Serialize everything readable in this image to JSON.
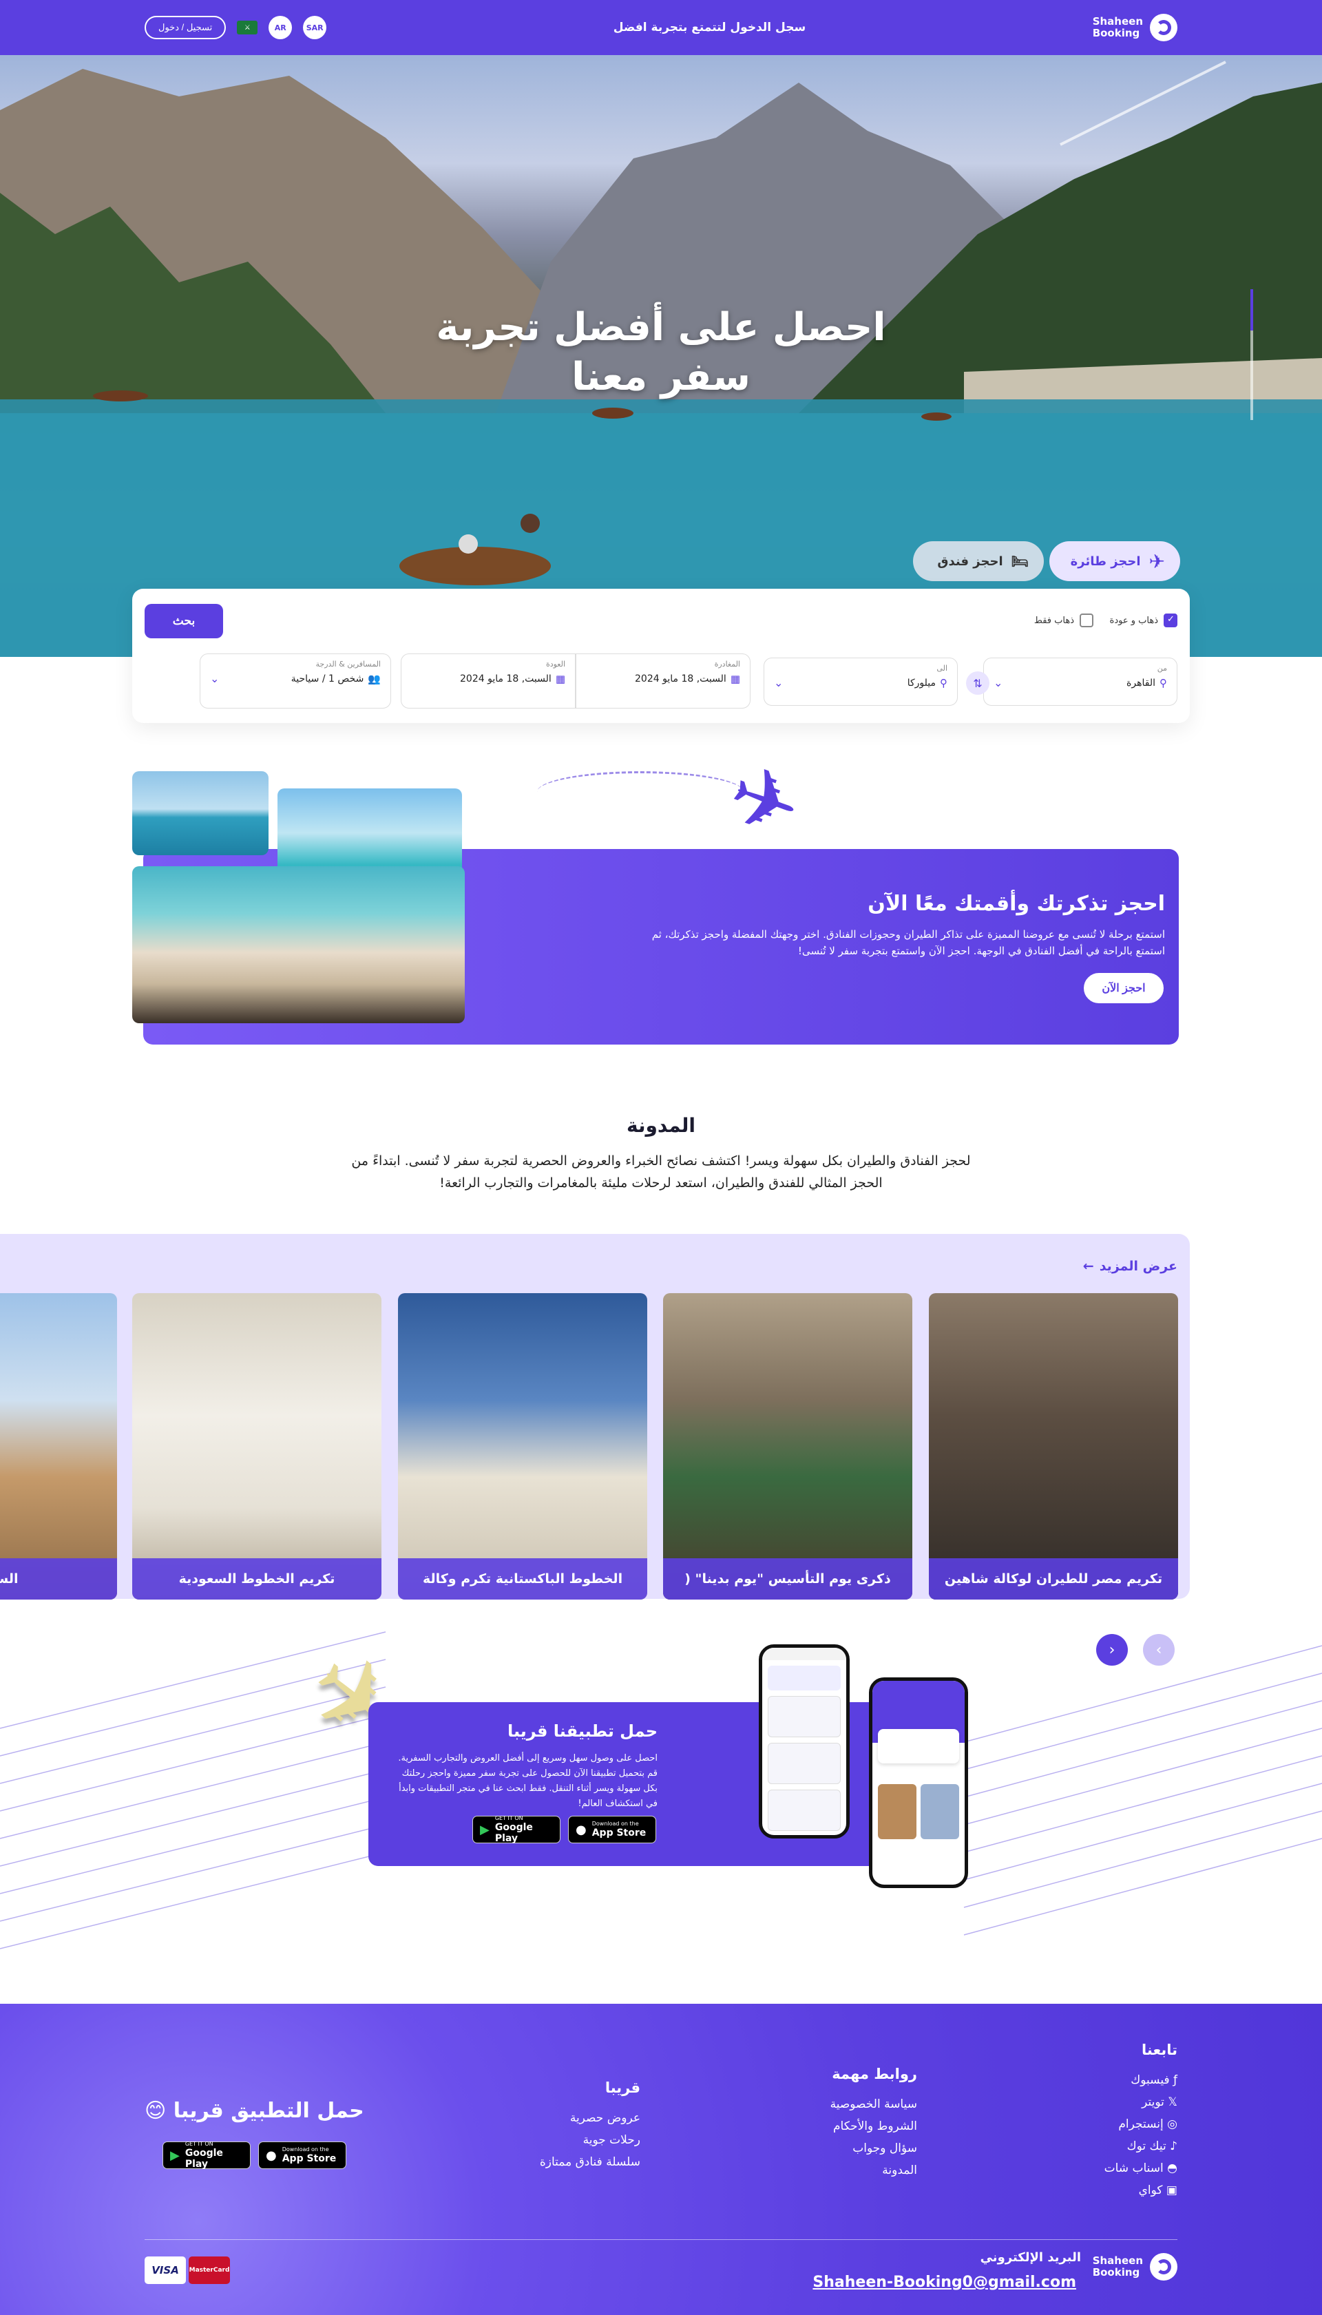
{
  "header": {
    "brand_line1": "Shaheen",
    "brand_line2": "Booking",
    "center_text": "سجل الدخول لتتمتع بتجربة افضل",
    "login_label": "تسجيل / دخول",
    "lang_label": "AR",
    "currency_label": "SAR"
  },
  "hero": {
    "title_line1": "احصل على أفضل تجربة",
    "title_line2": "سفر معنا"
  },
  "tabs": {
    "flight": "احجز طائرة",
    "hotel": "احجز فندق"
  },
  "search": {
    "round_trip": "ذهاب و عودة",
    "one_way": "ذهاب فقط",
    "search_button": "بحث",
    "from_label": "من",
    "from_value": "القاهرة",
    "to_label": "الى",
    "to_value": "ميلوركا",
    "depart_label": "المغادرة",
    "depart_value": "السبت, 18 مايو 2024",
    "return_label": "العودة",
    "return_value": "السبت, 18 مايو 2024",
    "pax_label": "المسافرين & الدرجة",
    "pax_value": "شخص 1 / سياحية"
  },
  "promo": {
    "title": "احجز تذكرتك وأقمتك معًا الآن",
    "text": "استمتع برحلة لا تُنسى مع عروضنا المميزة على تذاكر الطيران وحجوزات الفنادق. اختر وجهتك المفضلة واحجز تذكرتك، ثم استمتع بالراحة في أفضل الفنادق في الوجهة. احجز الآن واستمتع بتجربة سفر لا تُنسى!",
    "button": "احجز الآن"
  },
  "blog": {
    "title": "المدونة",
    "text": "لحجز الفنادق والطيران بكل سهولة ويسر! اكتشف نصائح الخبراء والعروض الحصرية لتجربة سفر لا تُنسى. ابتداءً من الحجز المثالي للفندق والطيران، استعد لرحلات مليئة بالمغامرات والتجارب الرائعة!",
    "more": "عرض المزيد",
    "cards": [
      {
        "caption": "تكريم مصر للطيران لوكالة شاهين"
      },
      {
        "caption": "ذكرى يوم التأسيس \"يوم بدينا\" ("
      },
      {
        "caption": "الخطوط الباكستانية تكرم وكالة"
      },
      {
        "caption": "تكريم الخطوط السعودية"
      },
      {
        "caption": "السياحة"
      }
    ]
  },
  "app": {
    "title": "حمل تطبيقنا قريبا",
    "text": "احصل على وصول سهل وسريع إلى أفضل العروض والتجارب السفرية. قم بتحميل تطبيقنا الآن للحصول على تجربة سفر مميزة واحجز رحلتك بكل سهولة ويسر أثناء التنقل. فقط ابحث عنا في متجر التطبيقات وابدأ في استكشاف العالم!",
    "gp_small": "GET IT ON",
    "gp_big": "Google Play",
    "as_small": "Download on the",
    "as_big": "App Store"
  },
  "footer": {
    "follow_title": "تابعنا",
    "follow": [
      "فيسبوك",
      "تويتر",
      "إنستجرام",
      "تيك توك",
      "اسناب شات",
      "كواي"
    ],
    "links_title": "روابط مهمة",
    "links": [
      "سياسة الخصوصية",
      "الشروط والأحكام",
      "سؤال وجواب",
      "المدونة"
    ],
    "soon_title": "قريبا",
    "soon": [
      "عروض حصرية",
      "رحلات جوية",
      "سلسلة فنادق ممتازة"
    ],
    "app_title": "حمل التطبيق قريبا 😊",
    "email_label": "البريد الإلكتروني",
    "email": "Shaheen-Booking0@gmail.com",
    "visa": "VISA",
    "mastercard": "MasterCard"
  },
  "colors": {
    "primary": "#5b3fe0",
    "primary_light": "#e9e4ff"
  }
}
